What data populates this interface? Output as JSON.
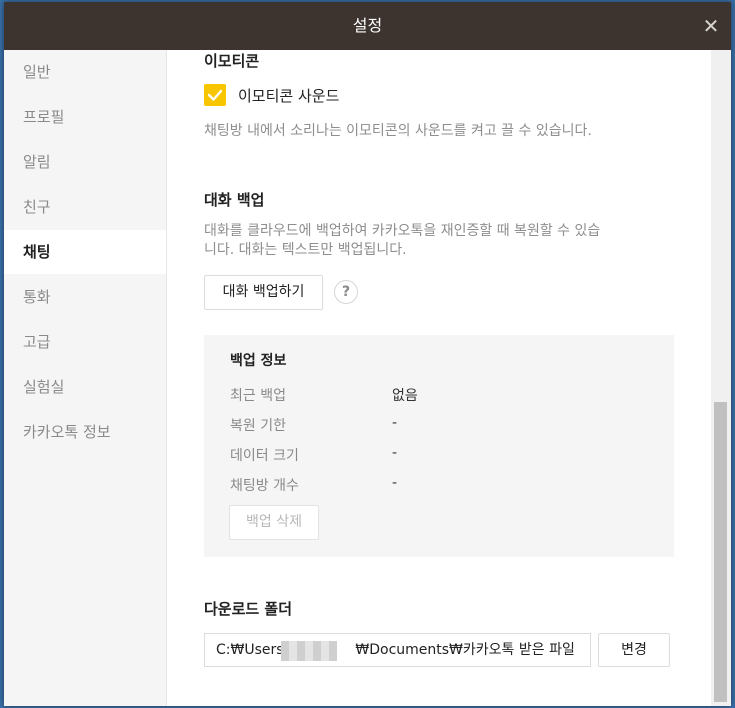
{
  "window": {
    "title": "설정",
    "close_glyph": "✕"
  },
  "sidebar": {
    "items": [
      {
        "label": "일반"
      },
      {
        "label": "프로필"
      },
      {
        "label": "알림"
      },
      {
        "label": "친구"
      },
      {
        "label": "채팅",
        "active": true
      },
      {
        "label": "통화"
      },
      {
        "label": "고급"
      },
      {
        "label": "실험실"
      },
      {
        "label": "카카오톡 정보"
      }
    ]
  },
  "emoticon": {
    "heading": "이모티콘",
    "sound_checkbox_label": "이모티콘 사운드",
    "sound_checked": true,
    "description": "채팅방 내에서 소리나는 이모티콘의 사운드를 켜고 끌 수 있습니다."
  },
  "backup": {
    "heading": "대화 백업",
    "description_line1": "대화를 클라우드에 백업하여 카카오톡을 재인증할 때 복원할 수 있습",
    "description_line2": "니다. 대화는 텍스트만 백업됩니다.",
    "backup_button": "대화 백업하기",
    "help_glyph": "?",
    "info": {
      "title": "백업 정보",
      "rows": [
        {
          "key": "최근 백업",
          "value": "없음"
        },
        {
          "key": "복원 기한",
          "value": "-"
        },
        {
          "key": "데이터 크기",
          "value": "-"
        },
        {
          "key": "채팅방 개수",
          "value": "-"
        }
      ],
      "delete_button": "백업 삭제"
    }
  },
  "download": {
    "heading": "다운로드 폴더",
    "path_prefix": "C:₩Users₩",
    "path_suffix": "₩Documents₩카카오톡 받은 파일",
    "change_button": "변경"
  },
  "colors": {
    "titlebar": "#3d342f",
    "checkbox_accent": "#f7c600",
    "sidebar_bg": "#f5f5f5"
  }
}
